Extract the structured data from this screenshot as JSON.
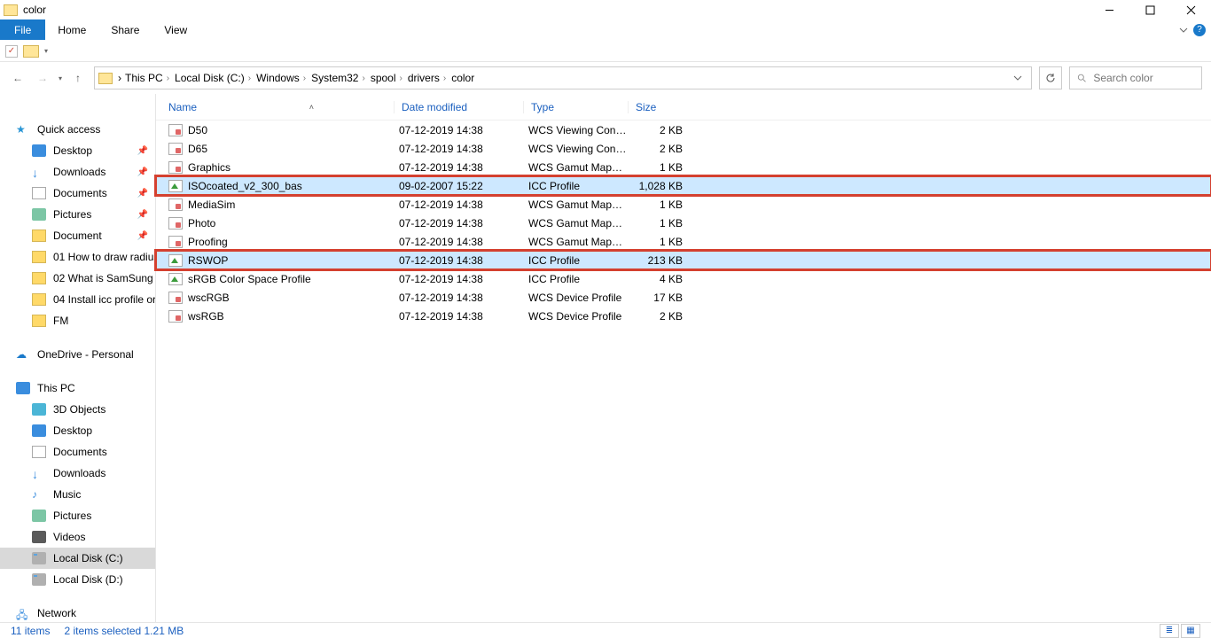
{
  "window": {
    "title": "color"
  },
  "ribbon": {
    "file": "File",
    "home": "Home",
    "share": "Share",
    "view": "View"
  },
  "breadcrumbs": [
    "This PC",
    "Local Disk (C:)",
    "Windows",
    "System32",
    "spool",
    "drivers",
    "color"
  ],
  "search": {
    "placeholder": "Search color"
  },
  "sidebar": {
    "quick": {
      "header": "Quick access",
      "items": [
        {
          "label": "Desktop"
        },
        {
          "label": "Downloads"
        },
        {
          "label": "Documents"
        },
        {
          "label": "Pictures"
        },
        {
          "label": "Document"
        },
        {
          "label": "01 How to draw radius"
        },
        {
          "label": "02 What is SamSung c"
        },
        {
          "label": "04 Install icc profile or"
        },
        {
          "label": "FM"
        }
      ]
    },
    "onedrive": {
      "label": "OneDrive - Personal"
    },
    "thispc": {
      "header": "This PC",
      "items": [
        {
          "label": "3D Objects"
        },
        {
          "label": "Desktop"
        },
        {
          "label": "Documents"
        },
        {
          "label": "Downloads"
        },
        {
          "label": "Music"
        },
        {
          "label": "Pictures"
        },
        {
          "label": "Videos"
        },
        {
          "label": "Local Disk (C:)"
        },
        {
          "label": "Local Disk (D:)"
        }
      ]
    },
    "network": {
      "label": "Network"
    }
  },
  "columns": {
    "name": "Name",
    "date": "Date modified",
    "type": "Type",
    "size": "Size"
  },
  "files": [
    {
      "name": "D50",
      "date": "07-12-2019 14:38",
      "type": "WCS Viewing Con…",
      "size": "2 KB",
      "icon": "profile"
    },
    {
      "name": "D65",
      "date": "07-12-2019 14:38",
      "type": "WCS Viewing Con…",
      "size": "2 KB",
      "icon": "profile"
    },
    {
      "name": "Graphics",
      "date": "07-12-2019 14:38",
      "type": "WCS Gamut Map…",
      "size": "1 KB",
      "icon": "profile"
    },
    {
      "name": "ISOcoated_v2_300_bas",
      "date": "09-02-2007 15:22",
      "type": "ICC Profile",
      "size": "1,028 KB",
      "icon": "icc",
      "selected": true,
      "highlight": true
    },
    {
      "name": "MediaSim",
      "date": "07-12-2019 14:38",
      "type": "WCS Gamut Map…",
      "size": "1 KB",
      "icon": "profile"
    },
    {
      "name": "Photo",
      "date": "07-12-2019 14:38",
      "type": "WCS Gamut Map…",
      "size": "1 KB",
      "icon": "profile"
    },
    {
      "name": "Proofing",
      "date": "07-12-2019 14:38",
      "type": "WCS Gamut Map…",
      "size": "1 KB",
      "icon": "profile"
    },
    {
      "name": "RSWOP",
      "date": "07-12-2019 14:38",
      "type": "ICC Profile",
      "size": "213 KB",
      "icon": "icc",
      "selected": true,
      "highlight": true
    },
    {
      "name": "sRGB Color Space Profile",
      "date": "07-12-2019 14:38",
      "type": "ICC Profile",
      "size": "4 KB",
      "icon": "icc"
    },
    {
      "name": "wscRGB",
      "date": "07-12-2019 14:38",
      "type": "WCS Device Profile",
      "size": "17 KB",
      "icon": "profile"
    },
    {
      "name": "wsRGB",
      "date": "07-12-2019 14:38",
      "type": "WCS Device Profile",
      "size": "2 KB",
      "icon": "profile"
    }
  ],
  "status": {
    "items": "11 items",
    "selection": "2 items selected  1.21 MB"
  }
}
